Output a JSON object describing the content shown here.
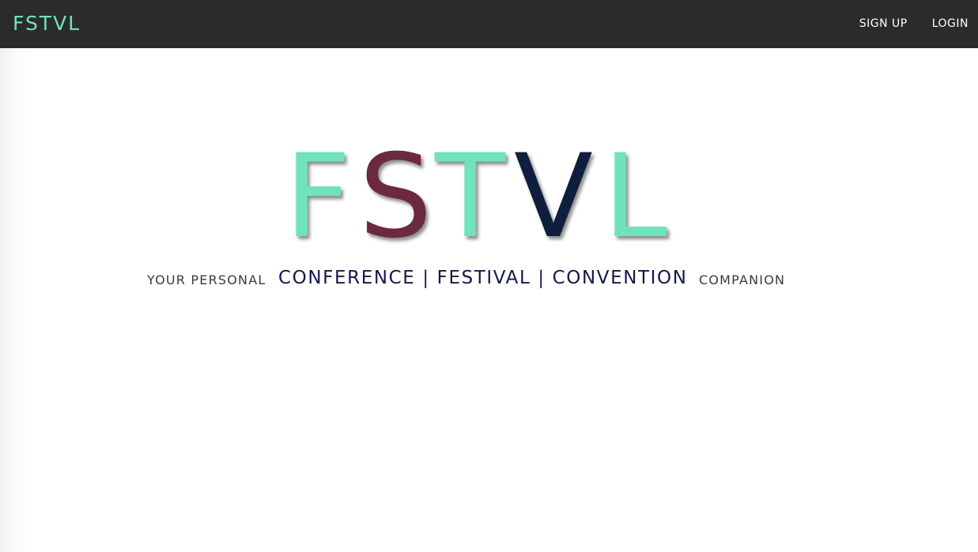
{
  "navbar": {
    "brand": "FSTVL",
    "links": [
      "SIGN UP",
      "LOGIN"
    ]
  },
  "hero": {
    "logo_letters": [
      "F",
      "S",
      "T",
      "V",
      "L"
    ],
    "tagline_prefix": "YOUR PERSONAL",
    "tagline_main": "CONFERENCE | FESTIVAL | CONVENTION",
    "tagline_suffix": "COMPANION"
  },
  "colors": {
    "navbar_bg": "#2b2b2b",
    "brand": "#6fe3be",
    "nav_text": "#ffffff",
    "logo_f": "#6fe3be",
    "logo_s": "#6b2a3e",
    "logo_t": "#6fe3be",
    "logo_v": "#0f1e3d",
    "logo_l": "#6fe3be",
    "tagline_main": "#14184a",
    "tagline_side": "#3a3a3a"
  }
}
